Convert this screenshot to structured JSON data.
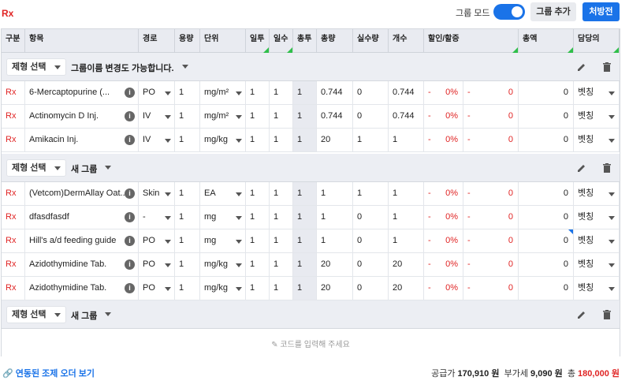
{
  "header": {
    "title": "Rx",
    "group_mode_label": "그룹 모드",
    "group_mode_on": true,
    "add_group_label": "그룹 추가",
    "prescribe_label": "처방전"
  },
  "columns": [
    "구분",
    "항목",
    "경로",
    "용량",
    "단위",
    "일투",
    "일수",
    "총투",
    "총량",
    "실수량",
    "개수",
    "할인/할증",
    "총액",
    "담당의"
  ],
  "groups": [
    {
      "type_select": "제형 선택",
      "name": "그룹이름 변경도 가능합니다.",
      "rows": [
        {
          "type": "Rx",
          "item": "6-Mercaptopurine (...",
          "route": "PO",
          "dose": "1",
          "unit": "mg/m²",
          "daily": "1",
          "days": "1",
          "total_dose": "1",
          "total_qty": "0.744",
          "actual_qty": "0",
          "count": "0.744",
          "disc_sign": "-",
          "disc_pct": "0%",
          "disc_sign2": "-",
          "disc_amt": "0",
          "amount": "0",
          "doctor": "벳칭"
        },
        {
          "type": "Rx",
          "item": "Actinomycin D Inj.",
          "route": "IV",
          "dose": "1",
          "unit": "mg/m²",
          "daily": "1",
          "days": "1",
          "total_dose": "1",
          "total_qty": "0.744",
          "actual_qty": "0",
          "count": "0.744",
          "disc_sign": "-",
          "disc_pct": "0%",
          "disc_sign2": "-",
          "disc_amt": "0",
          "amount": "0",
          "doctor": "벳칭"
        },
        {
          "type": "Rx",
          "item": "Amikacin Inj.",
          "route": "IV",
          "dose": "1",
          "unit": "mg/kg",
          "daily": "1",
          "days": "1",
          "total_dose": "1",
          "total_qty": "20",
          "actual_qty": "1",
          "count": "1",
          "disc_sign": "-",
          "disc_pct": "0%",
          "disc_sign2": "-",
          "disc_amt": "0",
          "amount": "0",
          "doctor": "벳칭"
        }
      ]
    },
    {
      "type_select": "제형 선택",
      "name": "새 그룹",
      "rows": [
        {
          "type": "Rx",
          "item": "(Vetcom)DermAllay Oat...",
          "route": "Skin",
          "dose": "1",
          "unit": "EA",
          "daily": "1",
          "days": "1",
          "total_dose": "1",
          "total_qty": "1",
          "actual_qty": "1",
          "count": "1",
          "disc_sign": "-",
          "disc_pct": "0%",
          "disc_sign2": "-",
          "disc_amt": "0",
          "amount": "0",
          "doctor": "벳칭"
        },
        {
          "type": "Rx",
          "item": "dfasdfasdf",
          "route": "-",
          "dose": "1",
          "unit": "mg",
          "daily": "1",
          "days": "1",
          "total_dose": "1",
          "total_qty": "1",
          "actual_qty": "0",
          "count": "1",
          "disc_sign": "-",
          "disc_pct": "0%",
          "disc_sign2": "-",
          "disc_amt": "0",
          "amount": "0",
          "doctor": "벳칭"
        },
        {
          "type": "Rx",
          "item": "Hill's a/d feeding guide",
          "route": "PO",
          "dose": "1",
          "unit": "mg",
          "daily": "1",
          "days": "1",
          "total_dose": "1",
          "total_qty": "1",
          "actual_qty": "0",
          "count": "1",
          "disc_sign": "-",
          "disc_pct": "0%",
          "disc_sign2": "-",
          "disc_amt": "0",
          "amount": "0",
          "doctor": "벳칭"
        },
        {
          "type": "Rx",
          "item": "Azidothymidine Tab.",
          "route": "PO",
          "dose": "1",
          "unit": "mg/kg",
          "daily": "1",
          "days": "1",
          "total_dose": "1",
          "total_qty": "20",
          "actual_qty": "0",
          "count": "20",
          "disc_sign": "-",
          "disc_pct": "0%",
          "disc_sign2": "-",
          "disc_amt": "0",
          "amount": "0",
          "doctor": "벳칭"
        },
        {
          "type": "Rx",
          "item": "Azidothymidine Tab.",
          "route": "PO",
          "dose": "1",
          "unit": "mg/kg",
          "daily": "1",
          "days": "1",
          "total_dose": "1",
          "total_qty": "20",
          "actual_qty": "0",
          "count": "20",
          "disc_sign": "-",
          "disc_pct": "0%",
          "disc_sign2": "-",
          "disc_amt": "0",
          "amount": "0",
          "doctor": "벳칭"
        }
      ]
    },
    {
      "type_select": "제형 선택",
      "name": "새 그룹",
      "rows": []
    }
  ],
  "code_input_placeholder": "코드를 입력해 주세요",
  "footer": {
    "linked_order_link": "연동된 조제 오더 보기",
    "supply_label": "공급가",
    "supply_value": "170,910 원",
    "vat_label": "부가세",
    "vat_value": "9,090 원",
    "total_label": "총",
    "total_value": "180,000 원"
  },
  "colors": {
    "accent": "#1a73e8",
    "rx_red": "#e02424",
    "header_bg": "#e9ebf1",
    "group_bg": "#eceef3"
  }
}
